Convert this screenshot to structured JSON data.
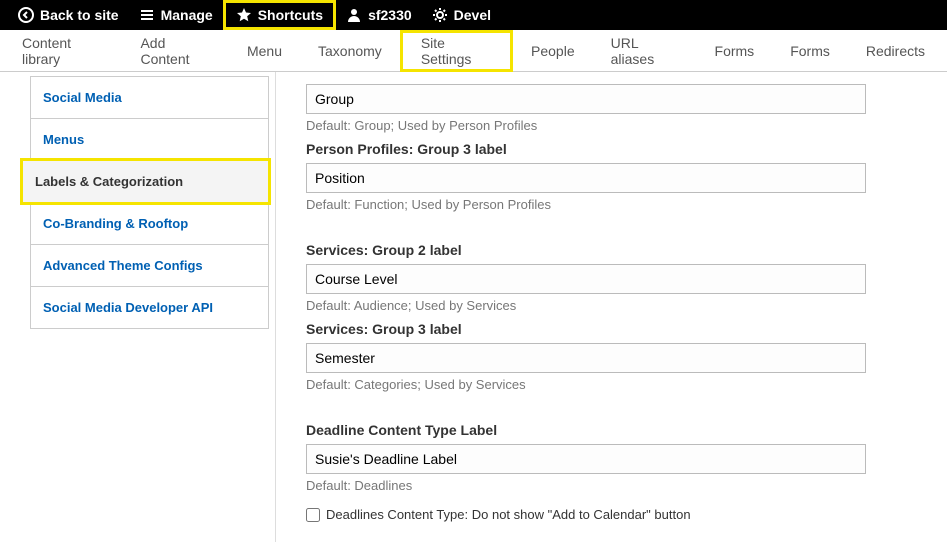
{
  "topbar": {
    "back_label": "Back to site",
    "manage_label": "Manage",
    "shortcuts_label": "Shortcuts",
    "user_label": "sf2330",
    "devel_label": "Devel"
  },
  "tabs": {
    "content_library": "Content library",
    "add_content": "Add Content",
    "menu": "Menu",
    "taxonomy": "Taxonomy",
    "site_settings": "Site Settings",
    "people": "People",
    "url_aliases": "URL aliases",
    "forms1": "Forms",
    "forms2": "Forms",
    "redirects": "Redirects"
  },
  "sidebar": {
    "items": [
      {
        "label": "Social Media"
      },
      {
        "label": "Menus"
      },
      {
        "label": "Labels & Categorization"
      },
      {
        "label": "Co-Branding & Rooftop"
      },
      {
        "label": "Advanced Theme Configs"
      },
      {
        "label": "Social Media Developer API"
      }
    ]
  },
  "fields": {
    "pp_g2": {
      "label": "",
      "value": "Group",
      "help": "Default: Group; Used by Person Profiles"
    },
    "pp_g3": {
      "label": "Person Profiles: Group 3 label",
      "value": "Position",
      "help": "Default: Function; Used by Person Profiles"
    },
    "sv_g2": {
      "label": "Services: Group 2 label",
      "value": "Course Level",
      "help": "Default: Audience; Used by Services"
    },
    "sv_g3": {
      "label": "Services: Group 3 label",
      "value": "Semester",
      "help": "Default: Categories; Used by Services"
    },
    "deadline": {
      "label": "Deadline Content Type Label",
      "value": "Susie's Deadline Label",
      "help": "Default: Deadlines"
    },
    "deadline_checkbox": "Deadlines Content Type: Do not show \"Add to Calendar\" button"
  }
}
